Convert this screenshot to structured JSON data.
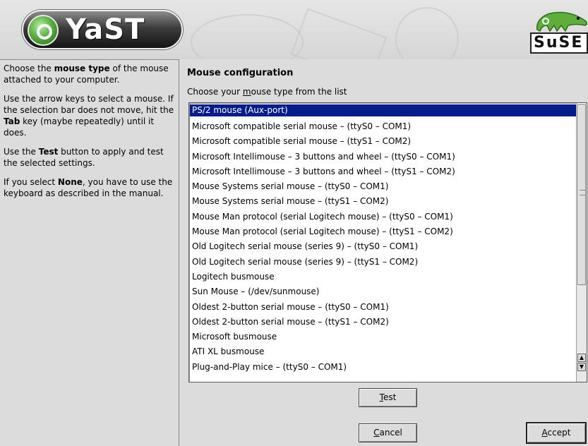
{
  "header": {
    "app_logo_text": "YaST",
    "vendor_logo_text": "SuSE"
  },
  "help": {
    "p1": {
      "a": "Choose the ",
      "b": "mouse type",
      "c": " of the mouse attached to your computer."
    },
    "p2": {
      "a": "Use the arrow keys to select a mouse. If the selection bar does not move, hit the ",
      "b": "Tab",
      "c": " key (maybe repeatedly) until it does."
    },
    "p3": {
      "a": "Use the ",
      "b": "Test",
      "c": " button to apply and test the selected settings."
    },
    "p4": {
      "a": "If you select ",
      "b": "None",
      "c": ", you have to use the keyboard as described in the manual."
    }
  },
  "main": {
    "title": "Mouse configuration",
    "list_label": {
      "before": "Choose your ",
      "mnemonic": "m",
      "after": "ouse type from the list"
    },
    "selected_index": 0,
    "items": [
      "PS/2 mouse (Aux-port)",
      "Microsoft compatible serial mouse – (ttyS0 – COM1)",
      "Microsoft compatible serial mouse – (ttyS1 – COM2)",
      "Microsoft Intellimouse – 3 buttons and wheel – (ttyS0 – COM1)",
      "Microsoft Intellimouse – 3 buttons and wheel – (ttyS1 – COM2)",
      "Mouse Systems serial mouse – (ttyS0 – COM1)",
      "Mouse Systems serial mouse – (ttyS1 – COM2)",
      "Mouse Man protocol (serial Logitech mouse) – (ttyS0 – COM1)",
      "Mouse Man protocol (serial Logitech mouse) – (ttyS1 – COM2)",
      "Old Logitech serial mouse (series 9) – (ttyS0 – COM1)",
      "Old Logitech serial mouse (series 9) – (ttyS1 – COM2)",
      "Logitech busmouse",
      "Sun Mouse – (/dev/sunmouse)",
      "Oldest 2-button serial mouse – (ttyS0 – COM1)",
      "Oldest 2-button serial mouse – (ttyS1 – COM2)",
      "Microsoft busmouse",
      "ATI XL busmouse",
      "Plug-and-Play mice – (ttyS0 – COM1)"
    ]
  },
  "buttons": {
    "test": {
      "mnemonic": "T",
      "rest": "est"
    },
    "cancel": {
      "mnemonic": "C",
      "rest": "ancel"
    },
    "accept": {
      "mnemonic": "A",
      "rest": "ccept"
    }
  },
  "colors": {
    "selection": "#061c8c",
    "background": "#dcdcdc"
  }
}
